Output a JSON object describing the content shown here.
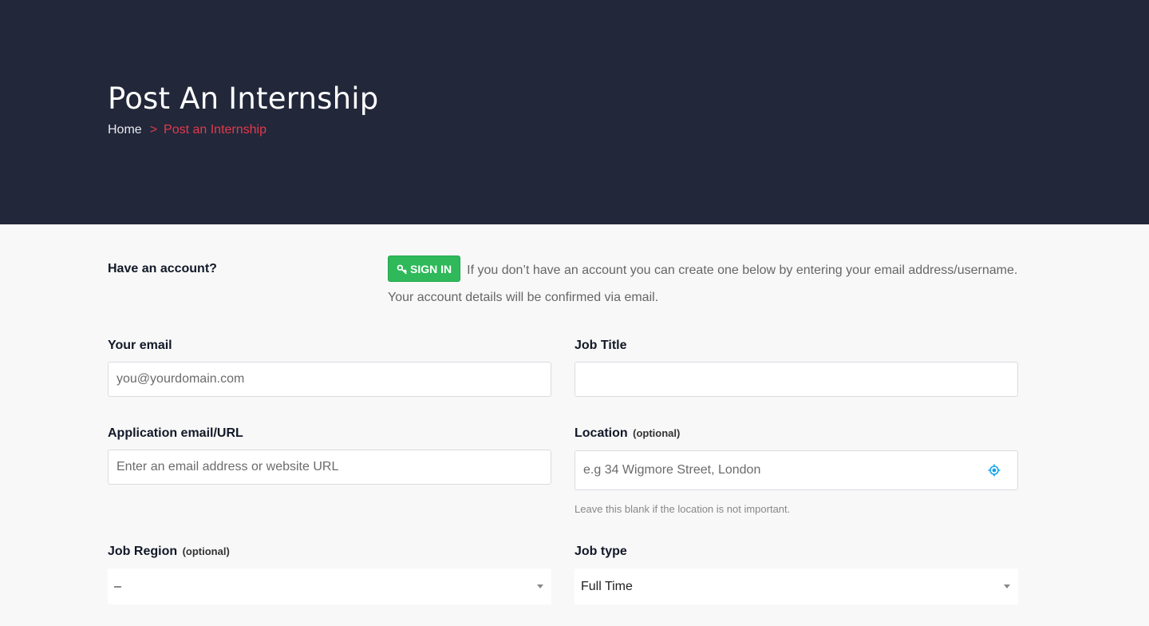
{
  "hero": {
    "title": "Post An Internship",
    "breadcrumb": {
      "home": "Home",
      "separator": ">",
      "current": "Post an Internship"
    }
  },
  "account": {
    "label": "Have an account?",
    "signin_label": "SIGN IN",
    "note": "If you don’t have an account you can create one below by entering your email address/username. Your account details will be confirmed via email."
  },
  "form": {
    "your_email": {
      "label": "Your email",
      "placeholder": "you@yourdomain.com"
    },
    "job_title": {
      "label": "Job Title",
      "placeholder": ""
    },
    "application": {
      "label": "Application email/URL",
      "placeholder": "Enter an email address or website URL"
    },
    "location": {
      "label": "Location",
      "optional": "(optional)",
      "placeholder": "e.g 34 Wigmore Street, London",
      "hint": "Leave this blank if the location is not important."
    },
    "job_region": {
      "label": "Job Region",
      "optional": "(optional)",
      "value": "–"
    },
    "job_type": {
      "label": "Job type",
      "value": "Full Time"
    }
  },
  "colors": {
    "hero_bg": "#22273a",
    "accent_red": "#e23a4b",
    "signin_green": "#2fb95a",
    "location_icon": "#1aa3e8"
  },
  "icons": {
    "signin": "key-icon",
    "location": "crosshair-icon",
    "select": "caret-down-icon"
  }
}
